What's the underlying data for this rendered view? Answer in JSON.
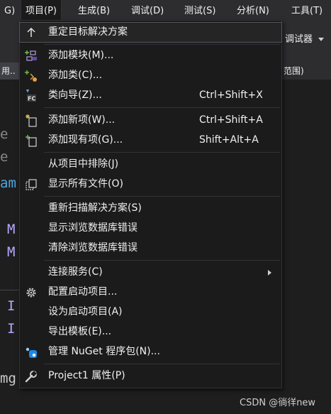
{
  "menubar": {
    "items": [
      {
        "label": "G)"
      },
      {
        "label": "项目(P)"
      },
      {
        "label": "生成(B)"
      },
      {
        "label": "调试(D)"
      },
      {
        "label": "测试(S)"
      },
      {
        "label": "分析(N)"
      },
      {
        "label": "工具(T)"
      }
    ]
  },
  "toolbar": {
    "debugger_label": "调试器"
  },
  "tabs": {
    "left_tab": "用..",
    "right_tab": "范围)"
  },
  "editor": {
    "lines": [
      "e",
      "e",
      "am",
      "M",
      "M",
      "I",
      "I",
      "mg"
    ]
  },
  "menu": {
    "items": [
      {
        "label": "重定目标解决方案",
        "shortcut": "",
        "icon": "arrow-up-icon"
      },
      {
        "label": "添加模块(M)...",
        "shortcut": "",
        "icon": "add-module-icon"
      },
      {
        "label": "添加类(C)...",
        "shortcut": "",
        "icon": "add-class-icon"
      },
      {
        "label": "类向导(Z)...",
        "shortcut": "Ctrl+Shift+X",
        "icon": "class-wizard-icon"
      },
      {
        "label": "添加新项(W)...",
        "shortcut": "Ctrl+Shift+A",
        "icon": "add-new-item-icon"
      },
      {
        "label": "添加现有项(G)...",
        "shortcut": "Shift+Alt+A",
        "icon": "add-existing-item-icon"
      },
      {
        "label": "从项目中排除(J)",
        "shortcut": "",
        "icon": ""
      },
      {
        "label": "显示所有文件(O)",
        "shortcut": "",
        "icon": "show-all-files-icon"
      },
      {
        "label": "重新扫描解决方案(S)",
        "shortcut": "",
        "icon": ""
      },
      {
        "label": "显示浏览数据库错误",
        "shortcut": "",
        "icon": ""
      },
      {
        "label": "清除浏览数据库错误",
        "shortcut": "",
        "icon": ""
      },
      {
        "label": "连接服务(C)",
        "shortcut": "",
        "icon": ""
      },
      {
        "label": "配置启动项目...",
        "shortcut": "",
        "icon": "gear-icon"
      },
      {
        "label": "设为启动项目(A)",
        "shortcut": "",
        "icon": ""
      },
      {
        "label": "导出模板(E)...",
        "shortcut": "",
        "icon": ""
      },
      {
        "label": "管理 NuGet 程序包(N)...",
        "shortcut": "",
        "icon": "nuget-icon"
      },
      {
        "label": "Project1 属性(P)",
        "shortcut": "",
        "icon": "wrench-icon"
      }
    ]
  },
  "watermark": "CSDN @徜徉new",
  "colors": {
    "accent": "#5b4aa8",
    "nuget": "#1e88e5",
    "menu_bg": "#1b1b1c"
  }
}
